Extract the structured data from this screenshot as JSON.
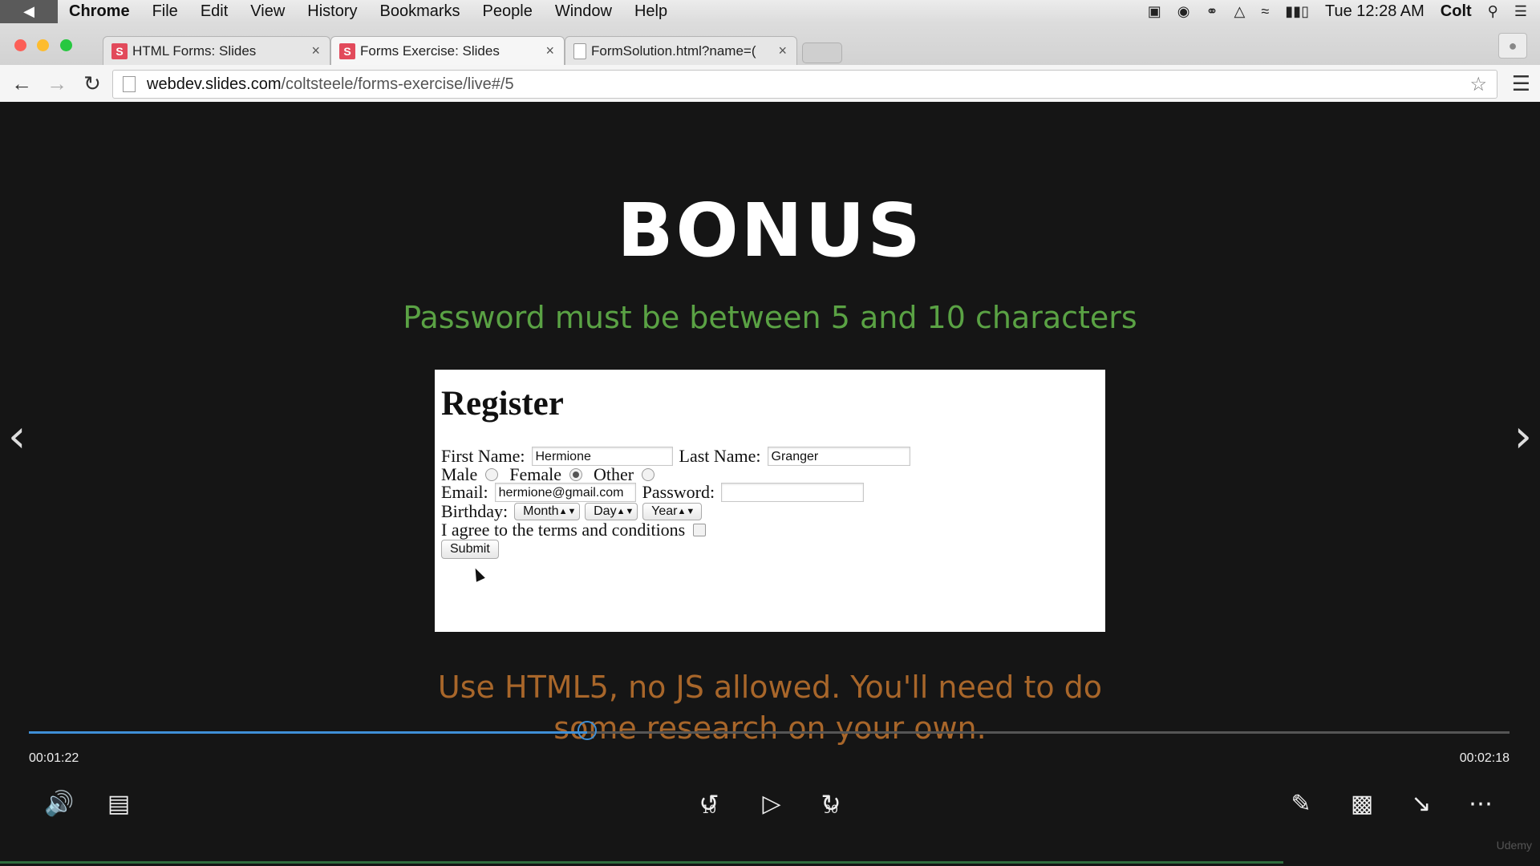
{
  "menubar": {
    "app": "Chrome",
    "items": [
      "File",
      "Edit",
      "View",
      "History",
      "Bookmarks",
      "People",
      "Window",
      "Help"
    ],
    "clock": "Tue 12:28 AM",
    "user": "Colt"
  },
  "tabs": [
    {
      "label": "HTML Forms: Slides",
      "favicon": "S"
    },
    {
      "label": "Forms Exercise: Slides",
      "favicon": "S"
    },
    {
      "label": "FormSolution.html?name=(",
      "favicon": "doc"
    }
  ],
  "omnibox": {
    "host": "webdev.slides.com",
    "path": "/coltsteele/forms-exercise/live#/5"
  },
  "slide": {
    "title": "BONUS",
    "subtitle": "Password must be between 5 and 10 characters",
    "note_line1": "Use HTML5, no JS allowed. You'll need to do",
    "note_line2": "some research on your own.",
    "colors": {
      "subtitle": "#5aa244",
      "note": "#a8662a"
    }
  },
  "form": {
    "heading": "Register",
    "first_name_label": "First Name:",
    "first_name_value": "Hermione",
    "last_name_label": "Last Name:",
    "last_name_value": "Granger",
    "gender": {
      "male": "Male",
      "female": "Female",
      "other": "Other",
      "selected": "Female"
    },
    "email_label": "Email:",
    "email_value": "hermione@gmail.com",
    "password_label": "Password:",
    "password_value": "",
    "birthday_label": "Birthday:",
    "month": "Month",
    "day": "Day",
    "year": "Year",
    "terms_label": "I agree to the terms and conditions",
    "submit_label": "Submit"
  },
  "player": {
    "current_time": "00:01:22",
    "duration": "00:02:18",
    "progress_fraction": 0.3768,
    "skip_back": "10",
    "skip_forward": "30",
    "watermark": "Udemy",
    "accent": "#3f8fd6"
  }
}
